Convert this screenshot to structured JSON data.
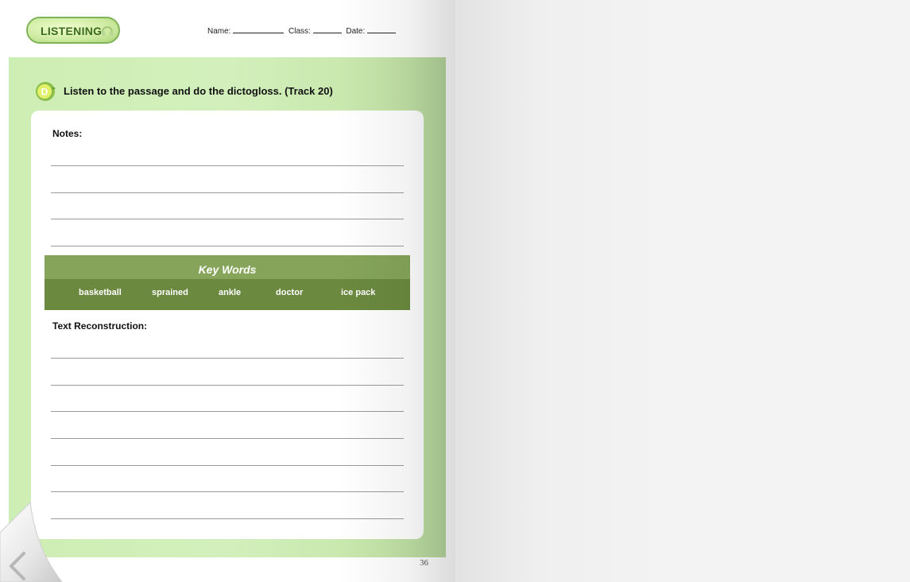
{
  "header": {
    "badge_label": "LISTENING",
    "name_label": "Name:",
    "class_label": "Class:",
    "date_label": "Date:"
  },
  "exercise": {
    "letter": "D",
    "instruction": "Listen to the passage and do the dictogloss.  (Track 20)"
  },
  "notes_label": "Notes:",
  "key_words": {
    "title": "Key Words",
    "items": [
      "basketball",
      "sprained",
      "ankle",
      "doctor",
      "ice pack"
    ]
  },
  "reconstruction_label": "Text Reconstruction:",
  "page_number": "36",
  "icons": {
    "badge_icon": "headphones-icon",
    "exercise_icon": "letter-circle-icon",
    "page_curl": "previous-page-arrow-icon"
  },
  "colors": {
    "panel": "#cdeeb4",
    "key_words_band": "#6b8a3f",
    "key_words_title_band": "#86a55a",
    "badge_text": "#3c6a1f"
  }
}
